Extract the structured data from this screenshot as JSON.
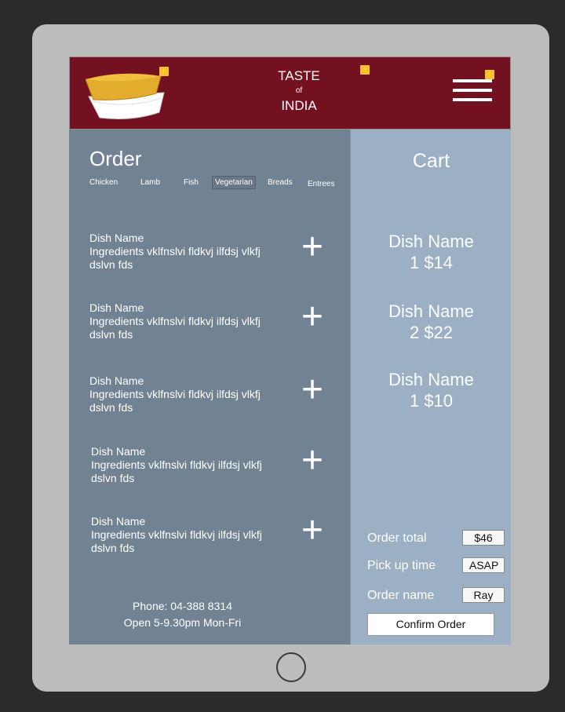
{
  "header": {
    "brand_line1": "TASTE",
    "brand_line2": "of",
    "brand_line3": "INDIA",
    "badge_glyph": "⚡"
  },
  "order": {
    "title": "Order",
    "tabs": [
      "Chicken",
      "Lamb",
      "Fish",
      "Vegetarian",
      "Breads",
      "Entrees"
    ],
    "active_tab": "Vegetarian",
    "dishes": [
      {
        "name": "Dish Name",
        "ingredients": "Ingredients vklfnslvi fldkvj ilfdsj vlkfj dslvn fds"
      },
      {
        "name": "Dish Name",
        "ingredients": "Ingredients vklfnslvi fldkvj ilfdsj vlkfj dslvn fds"
      },
      {
        "name": "Dish Name",
        "ingredients": "Ingredients vklfnslvi fldkvj ilfdsj vlkfj dslvn fds"
      },
      {
        "name": "Dish Name",
        "ingredients": "Ingredients vklfnslvi fldkvj ilfdsj vlkfj dslvn fds"
      },
      {
        "name": "Dish Name",
        "ingredients": "Ingredients vklfnslvi fldkvj ilfdsj vlkfj dslvn fds"
      }
    ],
    "add_glyph": "+",
    "phone": "Phone: 04-388 8314",
    "hours": "Open 5-9.30pm Mon-Fri"
  },
  "cart": {
    "title": "Cart",
    "items": [
      {
        "name": "Dish Name",
        "qty_price": "1 $14"
      },
      {
        "name": "Dish Name",
        "qty_price": "2 $22"
      },
      {
        "name": "Dish Name",
        "qty_price": "1 $10"
      }
    ],
    "order_total_label": "Order total",
    "order_total_value": "$46",
    "pickup_label": "Pick up time",
    "pickup_value": "ASAP",
    "order_name_label": "Order name",
    "order_name_value": "Ray",
    "confirm_label": "Confirm Order"
  },
  "colors": {
    "header_bg": "#741120",
    "order_panel_bg": "#718393",
    "cart_panel_bg": "#9bafc5"
  }
}
